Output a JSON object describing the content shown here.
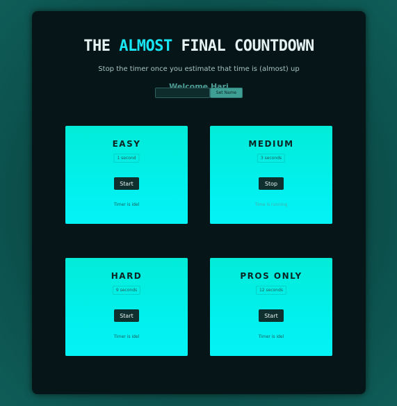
{
  "header": {
    "title_prefix": "The",
    "title_highlight": "Almost",
    "title_suffix": "Final Countdown",
    "subtitle": "Stop the timer once you estimate that time is (almost) up",
    "welcome": "Welcome Hari"
  },
  "name_form": {
    "input_value": "",
    "button_label": "Set Name"
  },
  "cards": [
    {
      "name": "Easy",
      "duration": "1 second",
      "button": "Start",
      "status": "Timer is idel"
    },
    {
      "name": "Medium",
      "duration": "3 seconds",
      "button": "Stop",
      "status": "Time is running"
    },
    {
      "name": "Hard",
      "duration": "9 seconds",
      "button": "Start",
      "status": "Timer is idel"
    },
    {
      "name": "Pros Only",
      "duration": "12 seconds",
      "button": "Start",
      "status": "Timer is idel"
    }
  ],
  "colors": {
    "accent": "#19e6f5",
    "card": "#02f0ed",
    "button": "#10302f"
  }
}
